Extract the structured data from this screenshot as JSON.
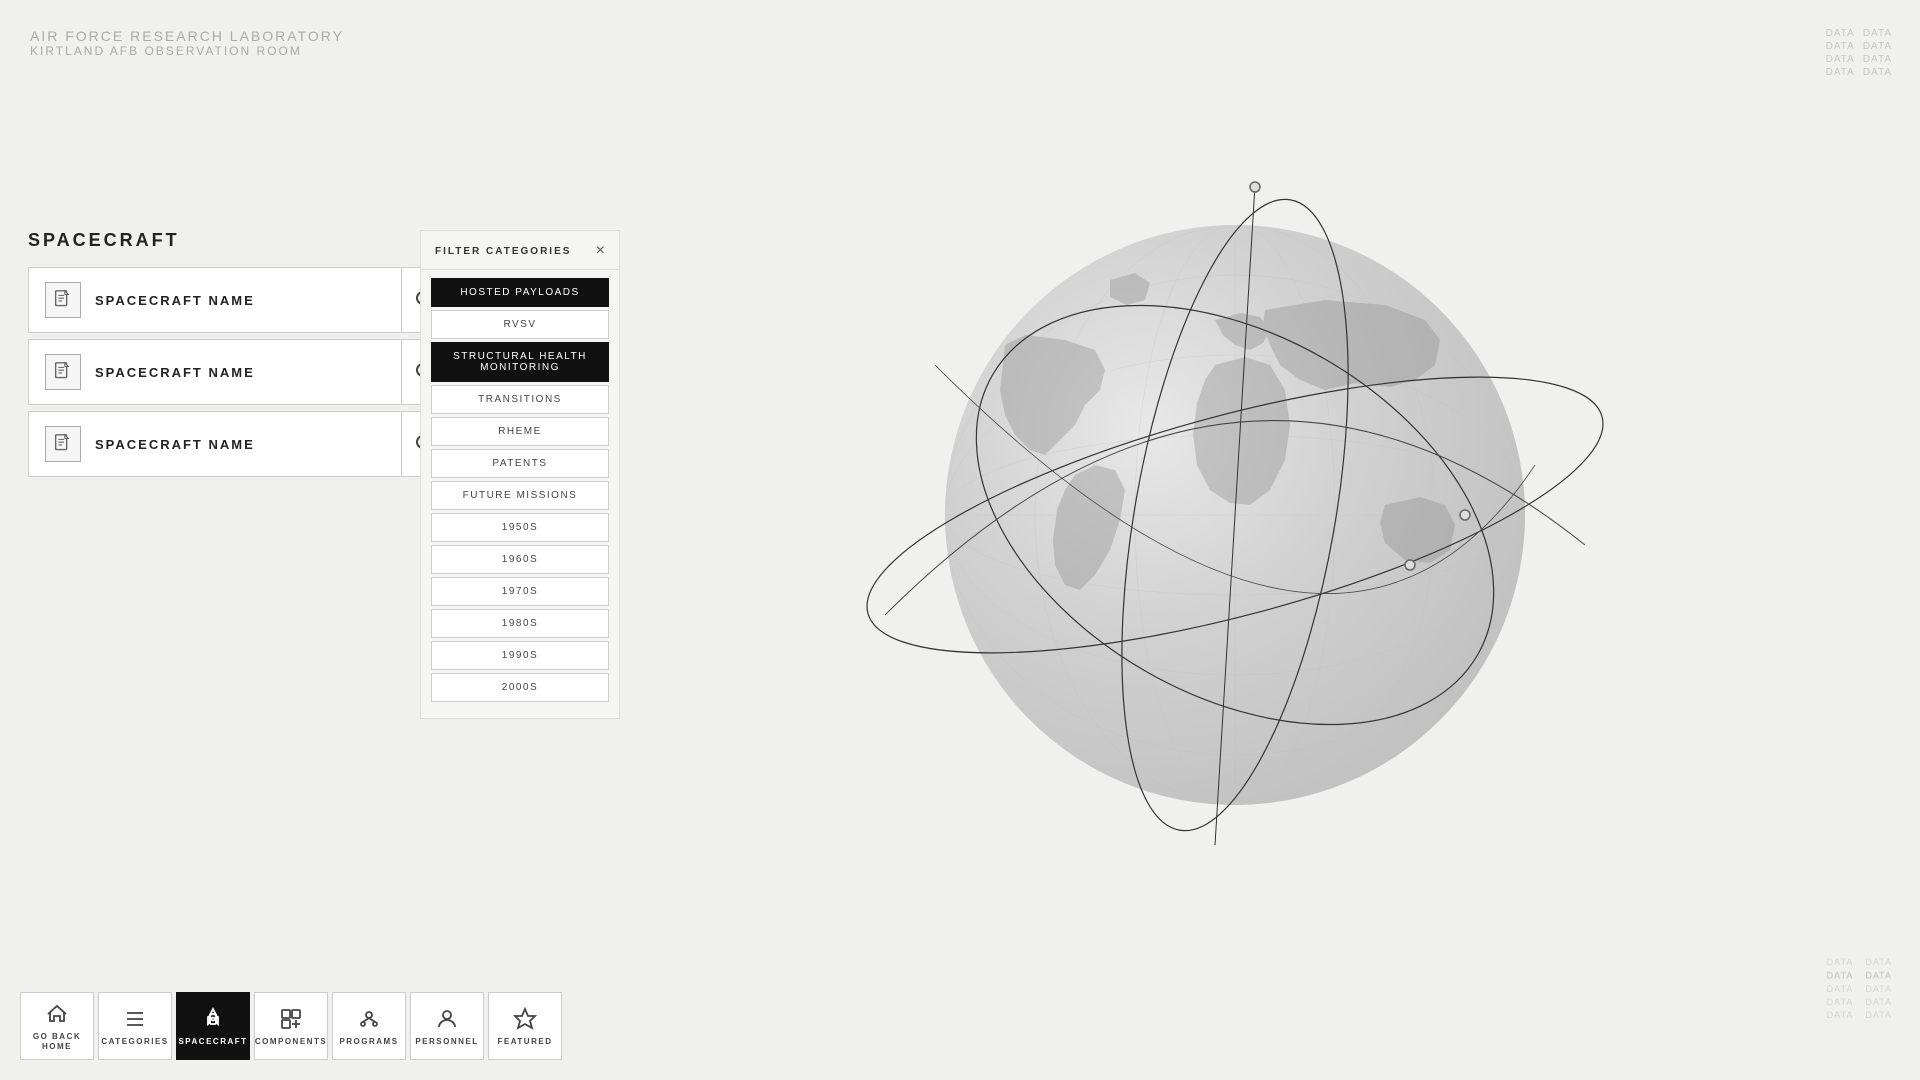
{
  "header": {
    "line1": "AIR FORCE RESEARCH LABORATORY",
    "line2": "KIRTLAND AFB OBSERVATION ROOM"
  },
  "corner_data_tr": {
    "items": [
      "DATA",
      "DATA",
      "DATA",
      "DATA",
      "DATA",
      "DATA",
      "DATA",
      "DATA"
    ]
  },
  "corner_data_br1": {
    "items": [
      "DATA",
      "DATA",
      "DATA",
      "DATA"
    ]
  },
  "corner_data_br2": {
    "items": [
      "DATA",
      "DATA",
      "DATA",
      "DATA",
      "DATA",
      "DATA",
      "DATA",
      "DATA"
    ]
  },
  "spacecraft": {
    "title": "SPACECRAFT",
    "items": [
      {
        "name": "SPACECRAFT NAME"
      },
      {
        "name": "SPACECRAFT NAME"
      },
      {
        "name": "SPACECRAFT NAME"
      }
    ]
  },
  "filter": {
    "title": "FILTER CATEGORIES",
    "close_label": "×",
    "items": [
      {
        "label": "HOSTED PAYLOADS",
        "active": true
      },
      {
        "label": "RVSV",
        "active": false
      },
      {
        "label": "STRUCTURAL HEALTH MONITORING",
        "active": true
      },
      {
        "label": "TRANSITIONS",
        "active": false
      },
      {
        "label": "RHEME",
        "active": false
      },
      {
        "label": "PATENTS",
        "active": false
      },
      {
        "label": "FUTURE MISSIONS",
        "active": false
      },
      {
        "label": "1950s",
        "active": false
      },
      {
        "label": "1960s",
        "active": false
      },
      {
        "label": "1970s",
        "active": false
      },
      {
        "label": "1980s",
        "active": false
      },
      {
        "label": "1990s",
        "active": false
      },
      {
        "label": "2000s",
        "active": false
      }
    ]
  },
  "nav": {
    "items": [
      {
        "label": "GO BACK HOME",
        "icon": "home-icon",
        "active": false
      },
      {
        "label": "CATEGORIES",
        "icon": "list-icon",
        "active": false
      },
      {
        "label": "SPACECRAFT",
        "icon": "spacecraft-icon",
        "active": true
      },
      {
        "label": "COMPONENTS",
        "icon": "components-icon",
        "active": false
      },
      {
        "label": "PROGRAMS",
        "icon": "programs-icon",
        "active": false
      },
      {
        "label": "PERSONNEL",
        "icon": "personnel-icon",
        "active": false
      },
      {
        "label": "FEATURED",
        "icon": "star-icon",
        "active": false
      }
    ]
  }
}
